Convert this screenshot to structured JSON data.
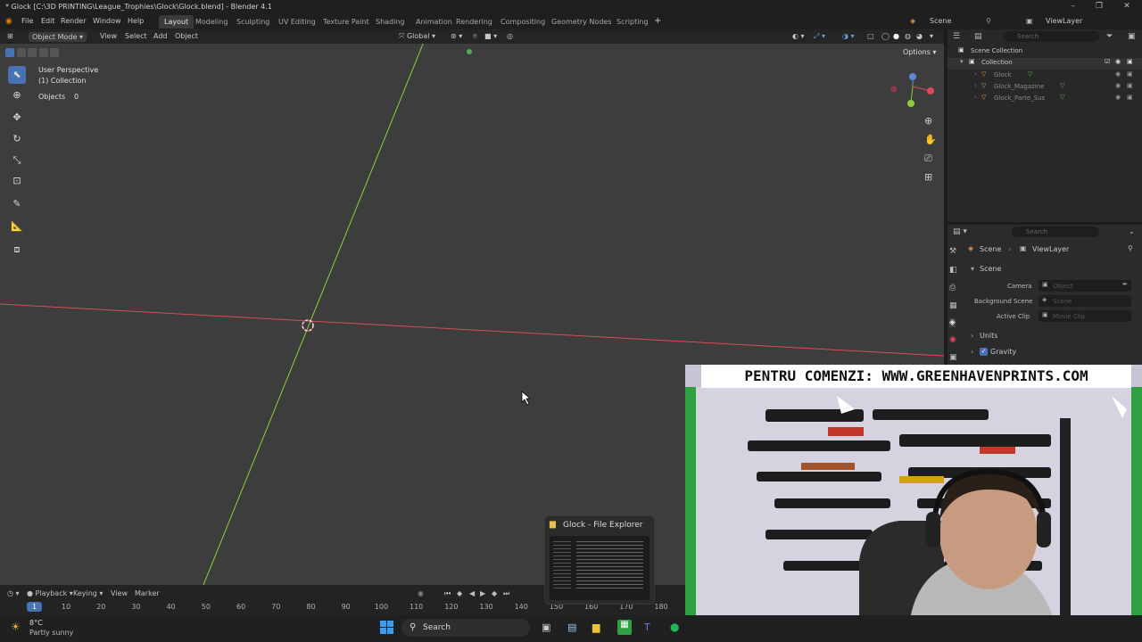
{
  "window": {
    "title": "* Glock [C:\\3D PRINTING\\League_Trophies\\Glock\\Glock.blend] - Blender 4.1"
  },
  "menu": {
    "file": "File",
    "edit": "Edit",
    "render": "Render",
    "window": "Window",
    "help": "Help"
  },
  "workspaces": [
    "Layout",
    "Modeling",
    "Sculpting",
    "UV Editing",
    "Texture Paint",
    "Shading",
    "Animation",
    "Rendering",
    "Compositing",
    "Geometry Nodes",
    "Scripting"
  ],
  "topright": {
    "scene": "Scene",
    "viewlayer": "ViewLayer"
  },
  "viewport_header": {
    "mode": "Object Mode",
    "view": "View",
    "select": "Select",
    "add": "Add",
    "object": "Object",
    "orientation": "Global",
    "options": "Options"
  },
  "overlay_text": {
    "perspective": "User Perspective",
    "collection": "(1) Collection",
    "objects_label": "Objects",
    "objects_count": "0"
  },
  "outliner": {
    "search_placeholder": "Search",
    "root": "Scene Collection",
    "collection": "Collection",
    "items": [
      "Glock",
      "Glock_Magazine",
      "Glock_Parte_Sus"
    ]
  },
  "properties": {
    "search_placeholder": "Search",
    "breadcrumb_scene": "Scene",
    "breadcrumb_viewlayer": "ViewLayer",
    "panel": "Scene",
    "camera_label": "Camera",
    "camera_value": "Object",
    "bg_scene_label": "Background Scene",
    "bg_scene_value": "Scene",
    "active_clip_label": "Active Clip",
    "active_clip_value": "Movie Clip",
    "units": "Units",
    "gravity": "Gravity"
  },
  "timeline": {
    "playback": "Playback",
    "keying": "Keying",
    "view": "View",
    "marker": "Marker",
    "current_frame": "1",
    "ticks": [
      "10",
      "20",
      "30",
      "40",
      "50",
      "60",
      "70",
      "80",
      "90",
      "100",
      "110",
      "120",
      "130",
      "140",
      "150",
      "160",
      "170",
      "180"
    ]
  },
  "taskbar": {
    "weather_temp": "8°C",
    "weather_desc": "Partly sunny",
    "search": "Search"
  },
  "explorer_popup": {
    "title": "Glock - File Explorer"
  },
  "webcam": {
    "banner": "PENTRU COMENZI: WWW.GREENHAVENPRINTS.COM"
  },
  "colors": {
    "accent": "#4772b3",
    "x_axis": "#d84a5a",
    "y_axis": "#8ccf3c",
    "viewport_bg": "#3d3d3d"
  }
}
